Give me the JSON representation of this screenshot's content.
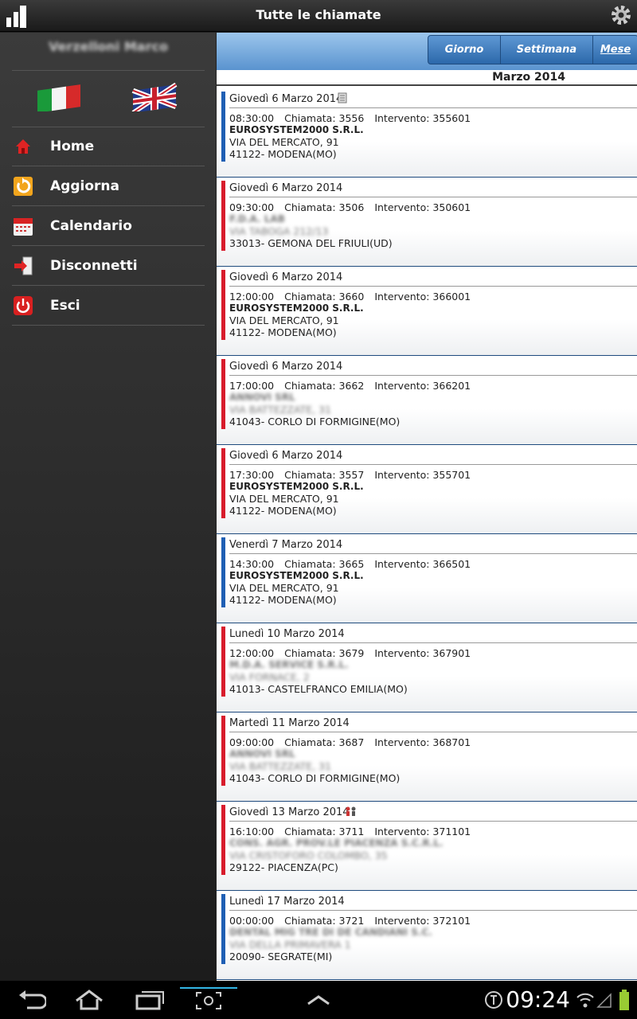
{
  "app": {
    "title": "Tutte le chiamate"
  },
  "sidebar": {
    "username": "Verzelloni Marco",
    "items": [
      {
        "label": "Home",
        "icon": "home-icon"
      },
      {
        "label": "Aggiorna",
        "icon": "refresh-icon"
      },
      {
        "label": "Calendario",
        "icon": "calendar-icon"
      },
      {
        "label": "Disconnetti",
        "icon": "logout-icon"
      },
      {
        "label": "Esci",
        "icon": "power-icon"
      }
    ]
  },
  "nav": {
    "tabs": [
      {
        "label": "Giorno"
      },
      {
        "label": "Settimana"
      },
      {
        "label": "Mese"
      }
    ],
    "active": "Mese"
  },
  "month": "Marzo 2014",
  "calls": [
    {
      "date": "Giovedì 6 Marzo 2014",
      "time": "08:30:00",
      "chiamata": "Chiamata: 3556",
      "intervento": "Intervento: 355601",
      "client": "EUROSYSTEM2000 S.R.L.",
      "address": "VIA DEL MERCATO, 91",
      "city": "41122- MODENA(MO)",
      "color": "#1f5fb4",
      "blurred": false
    },
    {
      "date": "Giovedì 6 Marzo 2014",
      "time": "09:30:00",
      "chiamata": "Chiamata: 3506",
      "intervento": "Intervento: 350601",
      "client": "F.D.A. LAB",
      "address": "VIA TABOGA 212/13",
      "city": "33013- GEMONA DEL FRIULI(UD)",
      "color": "#d81c2c",
      "blurred": true
    },
    {
      "date": "Giovedì 6 Marzo 2014",
      "time": "12:00:00",
      "chiamata": "Chiamata: 3660",
      "intervento": "Intervento: 366001",
      "client": "EUROSYSTEM2000 S.R.L.",
      "address": "VIA DEL MERCATO, 91",
      "city": "41122- MODENA(MO)",
      "color": "#d81c2c",
      "blurred": false
    },
    {
      "date": "Giovedì 6 Marzo 2014",
      "time": "17:00:00",
      "chiamata": "Chiamata: 3662",
      "intervento": "Intervento: 366201",
      "client": "ANNOVI SRL",
      "address": "VIA BATTEZZATE, 31",
      "city": "41043- CORLO DI FORMIGINE(MO)",
      "color": "#d81c2c",
      "blurred": true
    },
    {
      "date": "Giovedì 6 Marzo 2014",
      "time": "17:30:00",
      "chiamata": "Chiamata: 3557",
      "intervento": "Intervento: 355701",
      "client": "EUROSYSTEM2000 S.R.L.",
      "address": "VIA DEL MERCATO, 91",
      "city": "41122- MODENA(MO)",
      "color": "#d81c2c",
      "blurred": false
    },
    {
      "date": "Venerdì 7 Marzo 2014",
      "time": "14:30:00",
      "chiamata": "Chiamata: 3665",
      "intervento": "Intervento: 366501",
      "client": "EUROSYSTEM2000 S.R.L.",
      "address": "VIA DEL MERCATO, 91",
      "city": "41122- MODENA(MO)",
      "color": "#1f5fb4",
      "blurred": false
    },
    {
      "date": "Lunedì 10 Marzo 2014",
      "time": "12:00:00",
      "chiamata": "Chiamata: 3679",
      "intervento": "Intervento: 367901",
      "client": "M.D.A. SERVICE S.R.L.",
      "address": "VIA FORNACE, 2",
      "city": "41013- CASTELFRANCO EMILIA(MO)",
      "color": "#d81c2c",
      "blurred": true
    },
    {
      "date": "Martedì 11 Marzo 2014",
      "time": "09:00:00",
      "chiamata": "Chiamata: 3687",
      "intervento": "Intervento: 368701",
      "client": "ANNOVI SRL",
      "address": "VIA BATTEZZATE, 31",
      "city": "41043- CORLO DI FORMIGINE(MO)",
      "color": "#d81c2c",
      "blurred": true
    },
    {
      "date": "Giovedì 13 Marzo 2014",
      "time": "16:10:00",
      "chiamata": "Chiamata: 3711",
      "intervento": "Intervento: 371101",
      "client": "CONS. AGR. PROV.LE PIACENZA S.C.R.L.",
      "address": "VIA CRISTOFORO COLOMBO, 35",
      "city": "29122- PIACENZA(PC)",
      "color": "#d81c2c",
      "blurred": true
    },
    {
      "date": "Lunedì 17 Marzo 2014",
      "time": "00:00:00",
      "chiamata": "Chiamata: 3721",
      "intervento": "Intervento: 372101",
      "client": "DENTAL MIG TRE DI DE CANDIANI S.C.",
      "address": "VIA DELLA PRIMAVERA 1",
      "city": "20090- SEGRATE(MI)",
      "color": "#1f5fb4",
      "blurred": true
    }
  ],
  "status": {
    "time": "09:24"
  }
}
